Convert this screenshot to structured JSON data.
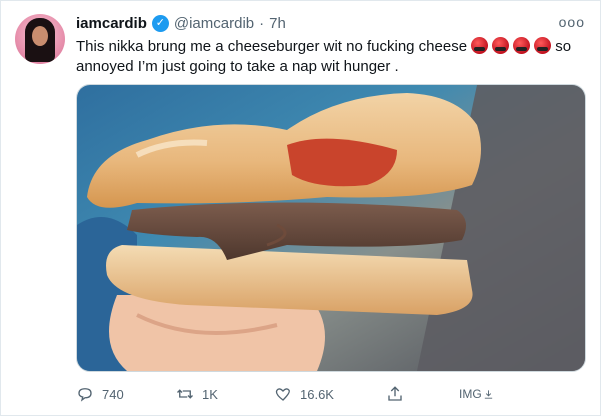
{
  "tweet": {
    "display_name": "iamcardib",
    "handle": "@iamcardib",
    "separator": "·",
    "time": "7h",
    "more": "ooo",
    "text_part1": "This nikka brung me a cheeseburger wit no fucking cheese ",
    "text_part2": "so annoyed I’m just going to take a nap wit hunger .",
    "emoji_count": 4
  },
  "actions": {
    "replies": "740",
    "retweets": "1K",
    "likes": "16.6K",
    "image_label": "IMG"
  },
  "colors": {
    "verified": "#1d9bf0",
    "secondary_text": "#536471",
    "border": "#cfd9de"
  }
}
